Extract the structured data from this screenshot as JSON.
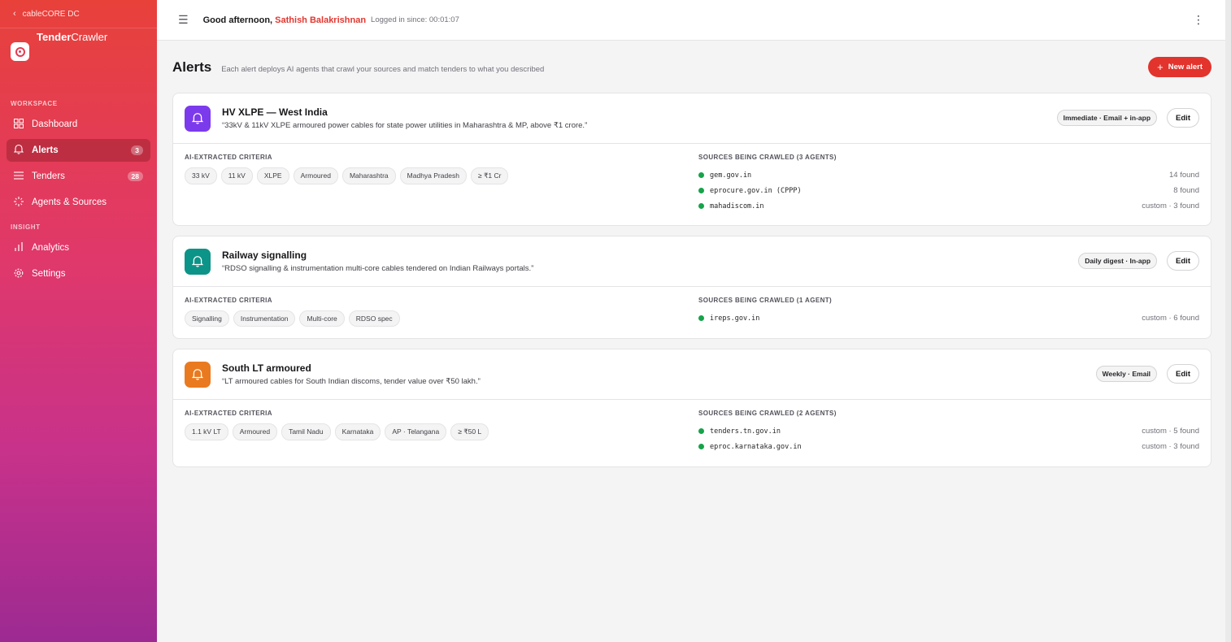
{
  "sidebar": {
    "back_label": "cableCORE DC",
    "brand_bold": "Tender",
    "brand_light": "Crawler",
    "sections": [
      {
        "label": "WORKSPACE",
        "items": [
          {
            "label": "Dashboard",
            "icon": "grid-icon",
            "badge": ""
          },
          {
            "label": "Alerts",
            "icon": "bell-icon",
            "badge": "3"
          },
          {
            "label": "Tenders",
            "icon": "list-icon",
            "badge": "28"
          },
          {
            "label": "Agents & Sources",
            "icon": "sparkle-icon",
            "badge": ""
          }
        ]
      },
      {
        "label": "INSIGHT",
        "items": [
          {
            "label": "Analytics",
            "icon": "bar-chart-icon"
          },
          {
            "label": "Settings",
            "icon": "settings-icon"
          }
        ]
      }
    ]
  },
  "topbar": {
    "greeting_prefix": "Good afternoon,",
    "user_name": "Sathish Balakrishnan",
    "since": "Logged in since: 00:01:07"
  },
  "page": {
    "title": "Alerts",
    "subtitle": "Each alert deploys AI agents that crawl your sources and match tenders to what you described",
    "new_alert_label": "New alert",
    "criteria_label": "AI-EXTRACTED CRITERIA"
  },
  "alerts": [
    {
      "title": "HV XLPE — West India",
      "description": "“33kV & 11kV XLPE armoured power cables for state power utilities in Maharashtra & MP, above ₹1 crore.”",
      "icon_color": "#7c3aed",
      "frequency": "Immediate · Email + in-app",
      "edit_label": "Edit",
      "criteria": [
        "33 kV",
        "11 kV",
        "XLPE",
        "Armoured",
        "Maharashtra",
        "Madhya Pradesh",
        "≥ ₹1 Cr"
      ],
      "sources_label": "SOURCES BEING CRAWLED (3 AGENTS)",
      "sources": [
        {
          "name": "gem.gov.in",
          "found": "14 found"
        },
        {
          "name": "eprocure.gov.in (CPPP)",
          "found": "8 found"
        },
        {
          "name": "mahadiscom.in",
          "found": "custom · 3 found"
        }
      ]
    },
    {
      "title": "Railway signalling",
      "description": "“RDSO signalling & instrumentation multi-core cables tendered on Indian Railways portals.”",
      "icon_color": "#0d9488",
      "frequency": "Daily digest · In-app",
      "edit_label": "Edit",
      "criteria": [
        "Signalling",
        "Instrumentation",
        "Multi-core",
        "RDSO spec"
      ],
      "sources_label": "SOURCES BEING CRAWLED (1 AGENT)",
      "sources": [
        {
          "name": "ireps.gov.in",
          "found": "custom · 6 found"
        }
      ]
    },
    {
      "title": "South LT armoured",
      "description": "“LT armoured cables for South Indian discoms, tender value over ₹50 lakh.”",
      "icon_color": "#ea7a1f",
      "frequency": "Weekly · Email",
      "edit_label": "Edit",
      "criteria": [
        "1.1 kV LT",
        "Armoured",
        "Tamil Nadu",
        "Karnataka",
        "AP · Telangana",
        "≥ ₹50 L"
      ],
      "sources_label": "SOURCES BEING CRAWLED (2 AGENTS)",
      "sources": [
        {
          "name": "tenders.tn.gov.in",
          "found": "custom · 5 found"
        },
        {
          "name": "eproc.karnataka.gov.in",
          "found": "custom · 3 found"
        }
      ]
    }
  ]
}
